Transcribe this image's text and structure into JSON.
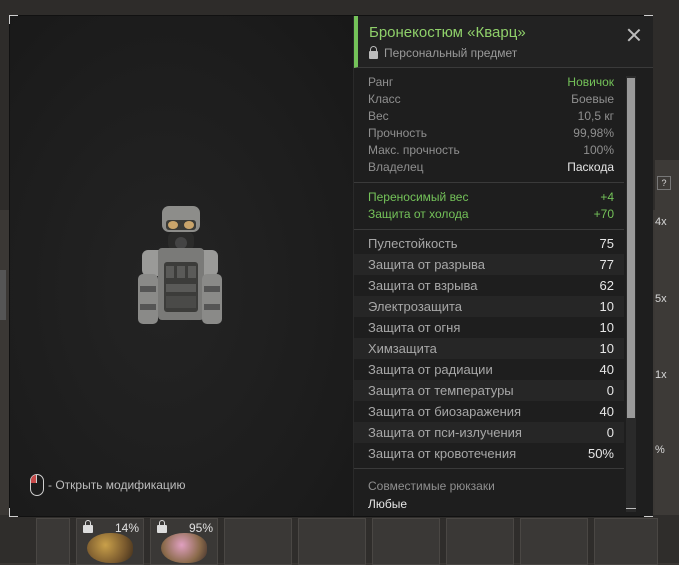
{
  "item": {
    "title": "Бронекостюм «Кварц»",
    "subtitle": "Персональный предмет"
  },
  "hint": "- Открыть модификацию",
  "properties": [
    {
      "label": "Ранг",
      "value": "Новичок",
      "accent": "green"
    },
    {
      "label": "Класс",
      "value": "Боевые",
      "accent": ""
    },
    {
      "label": "Вес",
      "value": "10,5 кг",
      "accent": ""
    },
    {
      "label": "Прочность",
      "value": "99,98%",
      "accent": ""
    },
    {
      "label": "Макс. прочность",
      "value": "100%",
      "accent": ""
    },
    {
      "label": "Владелец",
      "value": "Паскода",
      "accent": "white"
    }
  ],
  "bonuses": [
    {
      "label": "Переносимый вес",
      "value": "+4"
    },
    {
      "label": "Защита от холода",
      "value": "+70"
    }
  ],
  "stats": [
    {
      "label": "Пулестойкость",
      "value": "75"
    },
    {
      "label": "Защита от разрыва",
      "value": "77"
    },
    {
      "label": "Защита от взрыва",
      "value": "62"
    },
    {
      "label": "Электрозащита",
      "value": "10"
    },
    {
      "label": "Защита от огня",
      "value": "10"
    },
    {
      "label": "Химзащита",
      "value": "10"
    },
    {
      "label": "Защита от радиации",
      "value": "40"
    },
    {
      "label": "Защита от температуры",
      "value": "0"
    },
    {
      "label": "Защита от биозаражения",
      "value": "40"
    },
    {
      "label": "Защита от пси-излучения",
      "value": "0"
    },
    {
      "label": "Защита от кровотечения",
      "value": "50%"
    }
  ],
  "compatibility": {
    "label": "Совместимые рюкзаки",
    "value": "Любые"
  },
  "background": {
    "slot_percent_1": "14%",
    "slot_percent_2": "95%",
    "side_counts": [
      "4x",
      "5x",
      "1x",
      "%"
    ],
    "help_mark": "?"
  },
  "colors": {
    "accent": "#74c259",
    "panel": "#1e1e1e"
  }
}
